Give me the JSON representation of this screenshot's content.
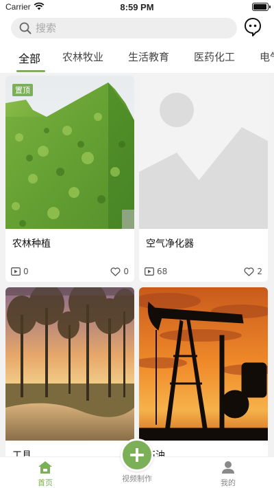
{
  "status_bar": {
    "carrier": "Carrier",
    "time": "8:59 PM"
  },
  "search": {
    "placeholder": "搜索"
  },
  "tabs": [
    {
      "label": "全部",
      "active": true
    },
    {
      "label": "农林牧业",
      "active": false
    },
    {
      "label": "生活教育",
      "active": false
    },
    {
      "label": "医药化工",
      "active": false
    },
    {
      "label": "电气",
      "active": false
    }
  ],
  "cards": [
    {
      "title": "农林种植",
      "badge": "置顶",
      "views": "0",
      "likes": "0",
      "image": "ivy-building-photo"
    },
    {
      "title": "空气净化器",
      "views": "68",
      "likes": "2",
      "image": "placeholder-image"
    },
    {
      "title": "工具",
      "image": "forest-sunset-photo"
    },
    {
      "title": "石油",
      "image": "oil-pump-sunset-photo"
    }
  ],
  "bottom_nav": {
    "home_label": "首页",
    "create_label": "视频制作",
    "mine_label": "我的"
  },
  "colors": {
    "accent": "#7cb058",
    "tab_underline": "#7cae5b",
    "background": "#f2f2f2"
  }
}
